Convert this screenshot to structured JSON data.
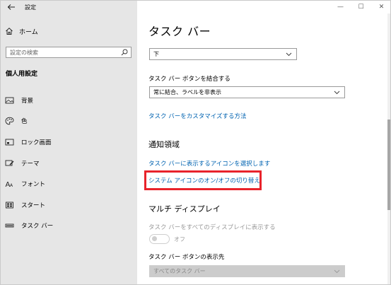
{
  "app": {
    "title": "設定"
  },
  "window_controls": {
    "minimize": "—",
    "maximize": "☐",
    "close": "✕"
  },
  "sidebar": {
    "home_label": "ホーム",
    "search_placeholder": "設定の検索",
    "section_title": "個人用設定",
    "items": [
      {
        "label": "背景",
        "icon": "picture-icon"
      },
      {
        "label": "色",
        "icon": "palette-icon"
      },
      {
        "label": "ロック画面",
        "icon": "lock-screen-icon"
      },
      {
        "label": "テーマ",
        "icon": "theme-brush-icon"
      },
      {
        "label": "フォント",
        "icon": "font-icon"
      },
      {
        "label": "スタート",
        "icon": "start-icon"
      },
      {
        "label": "タスク バー",
        "icon": "taskbar-icon"
      }
    ]
  },
  "main": {
    "title": "タスク バー",
    "position_value": "下",
    "combine_label": "タスク バー ボタンを結合する",
    "combine_value": "常に結合、ラベルを非表示",
    "customize_link": "タスク バーをカスタマイズする方法",
    "notification_heading": "通知領域",
    "select_icons_link": "タスク バーに表示するアイコンを選択します",
    "system_icons_link": "システム アイコンのオン/オフの切り替え",
    "multi_display_heading": "マルチ ディスプレイ",
    "show_all_displays_label": "タスク バーをすべてのディスプレイに表示する",
    "toggle_state": "オフ",
    "show_buttons_on_label": "タスク バー ボタンの表示先",
    "show_buttons_on_value": "すべてのタスク バー"
  },
  "colors": {
    "accent_link": "#0063b1",
    "highlight_box": "#e8232b",
    "sidebar_bg": "#e6e6e6"
  }
}
